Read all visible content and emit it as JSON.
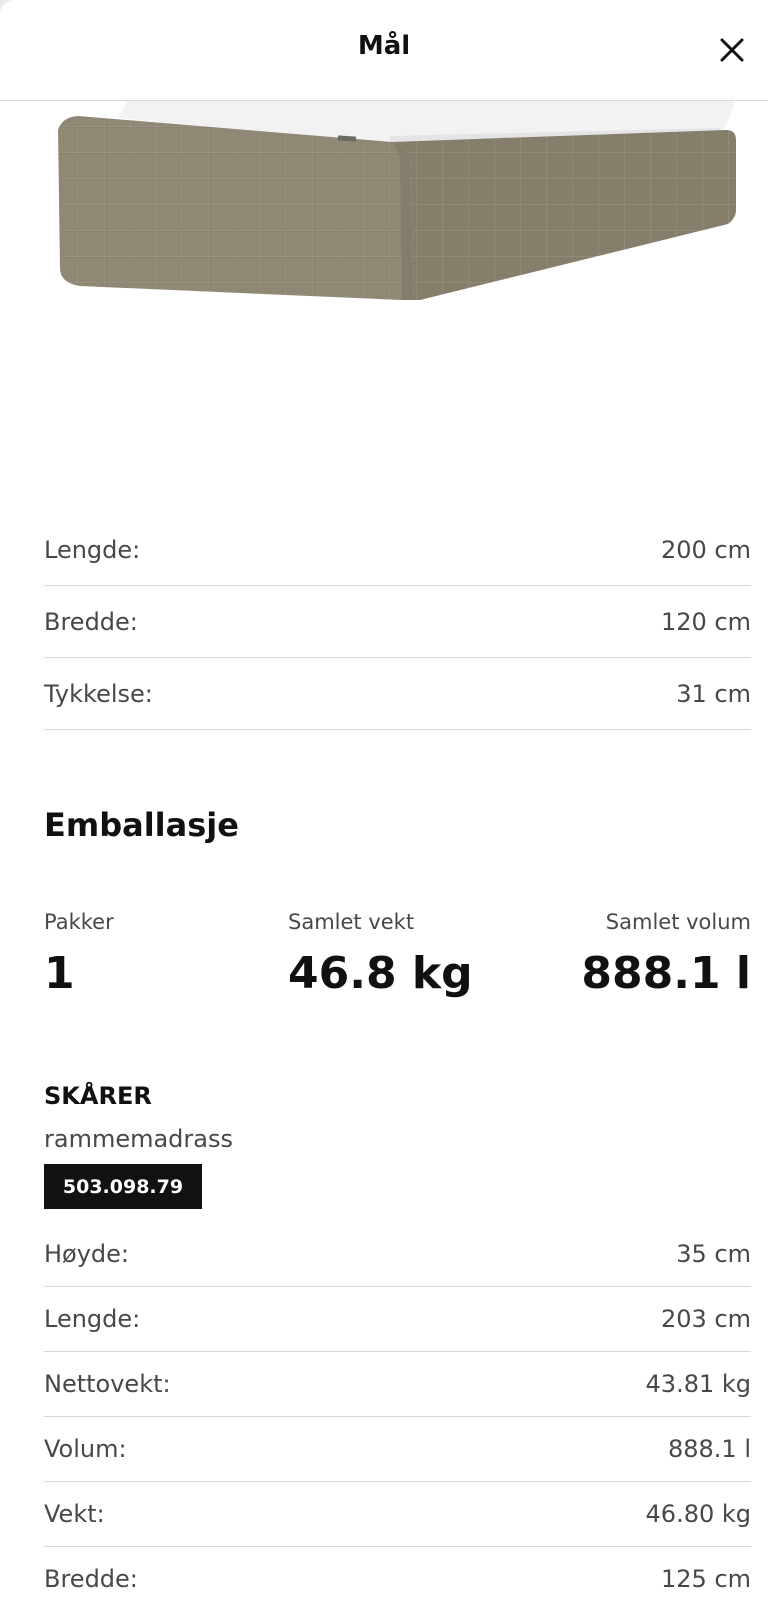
{
  "header": {
    "title": "Mål"
  },
  "dimensions": [
    {
      "label": "Lengde:",
      "value": "200 cm"
    },
    {
      "label": "Bredde:",
      "value": "120 cm"
    },
    {
      "label": "Tykkelse:",
      "value": "31 cm"
    }
  ],
  "packaging": {
    "title": "Emballasje",
    "packages_label": "Pakker",
    "packages_value": "1",
    "weight_label": "Samlet vekt",
    "weight_value": "46.8 kg",
    "volume_label": "Samlet volum",
    "volume_value": "888.1 l"
  },
  "product": {
    "name": "SKÅRER",
    "description": "rammemadrass",
    "article_number": "503.098.79",
    "details": [
      {
        "label": "Høyde:",
        "value": "35 cm"
      },
      {
        "label": "Lengde:",
        "value": "203 cm"
      },
      {
        "label": "Nettovekt:",
        "value": "43.81 kg"
      },
      {
        "label": "Volum:",
        "value": "888.1 l"
      },
      {
        "label": "Vekt:",
        "value": "46.80 kg"
      },
      {
        "label": "Bredde:",
        "value": "125 cm"
      }
    ]
  },
  "colors": {
    "fabric": "#8d8673",
    "text": "#111111",
    "muted": "#484848",
    "divider": "#d8d8d8"
  }
}
